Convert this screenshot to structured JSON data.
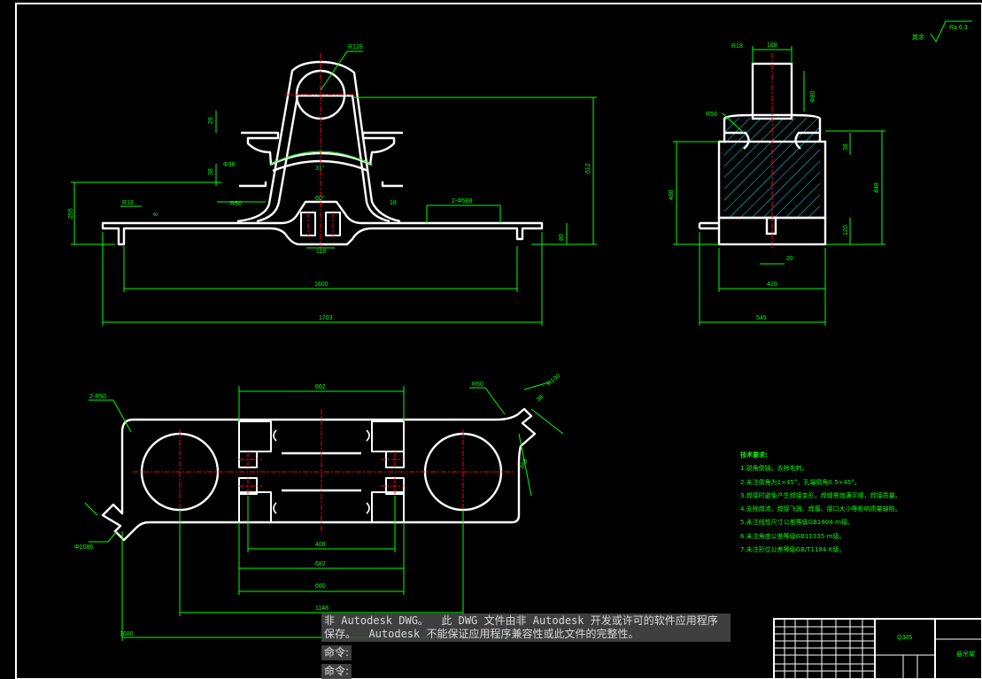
{
  "drawing": {
    "roughness_mark": {
      "label": "其余",
      "value": "Ra 6.3"
    },
    "front_view_dims": {
      "r_top": "R128",
      "r_left": "R18",
      "r_fillet": "R50",
      "angle_top": "31°",
      "angle_bottom": "60°",
      "holes": "2-Φ588",
      "d_small": "Φ38",
      "w_inner": "1600",
      "w_total": "1703",
      "h_total": "612",
      "h_left": "255",
      "h_right": "80",
      "dim_slot": "118",
      "dim_a": "28",
      "dim_b": "38",
      "dim_c": "18",
      "dim_d": "8"
    },
    "side_view_dims": {
      "r_top": "R18",
      "w_top": "168",
      "r_fillet": "R50",
      "d_top": "Φ80",
      "h_left": "488",
      "h_right": "448",
      "h_small": "38",
      "h_lower": "120",
      "w_gap": "20",
      "w_mid": "420",
      "w_total": "545"
    },
    "plan_view_dims": {
      "holes": "2-R50",
      "r_right": "R50",
      "w_662": "662",
      "w_408": "408",
      "w_682": "682",
      "w_660": "660",
      "w_1148": "1148",
      "w_1680": "1680",
      "d_left": "Φ1086",
      "dim_diag": "168",
      "dim_right": "R100",
      "dim_angle": "38"
    }
  },
  "tech_notes": {
    "title": "技术要求:",
    "items": [
      "1.锐角倒钝，去除毛刺。",
      "2.未注倒角为1×45°，孔端倒角0.5×45°。",
      "3.焊接时避免产生焊接变形，焊缝需饱满平顺，焊接质量。",
      "4.去除焊渣、焊接飞溅、焊瘤、接口大小等影响质量缺陷。",
      "5.未注线性尺寸公差等级GB1804-m级。",
      "6.未注角度公差等级GB11335-m级。",
      "7.未注形位公差等级GB/T1184-K级。"
    ]
  },
  "title_block": {
    "material": "Q345",
    "drawing_name": "悬吊架"
  },
  "command_line": {
    "message_line1": "非 Autodesk DWG。  此 DWG 文件由非 Autodesk 开发或许可的软件应用程序",
    "message_line2": "保存。  Autodesk 不能保证应用程序兼容性或此文件的完整性。",
    "prompt1": "命令:",
    "prompt2": "命令:"
  },
  "colors": {
    "background": "#000000",
    "geometry": "#ffffff",
    "dimension": "#00ff00",
    "centerline": "#ff0000",
    "hatch": "#00e5ff"
  }
}
